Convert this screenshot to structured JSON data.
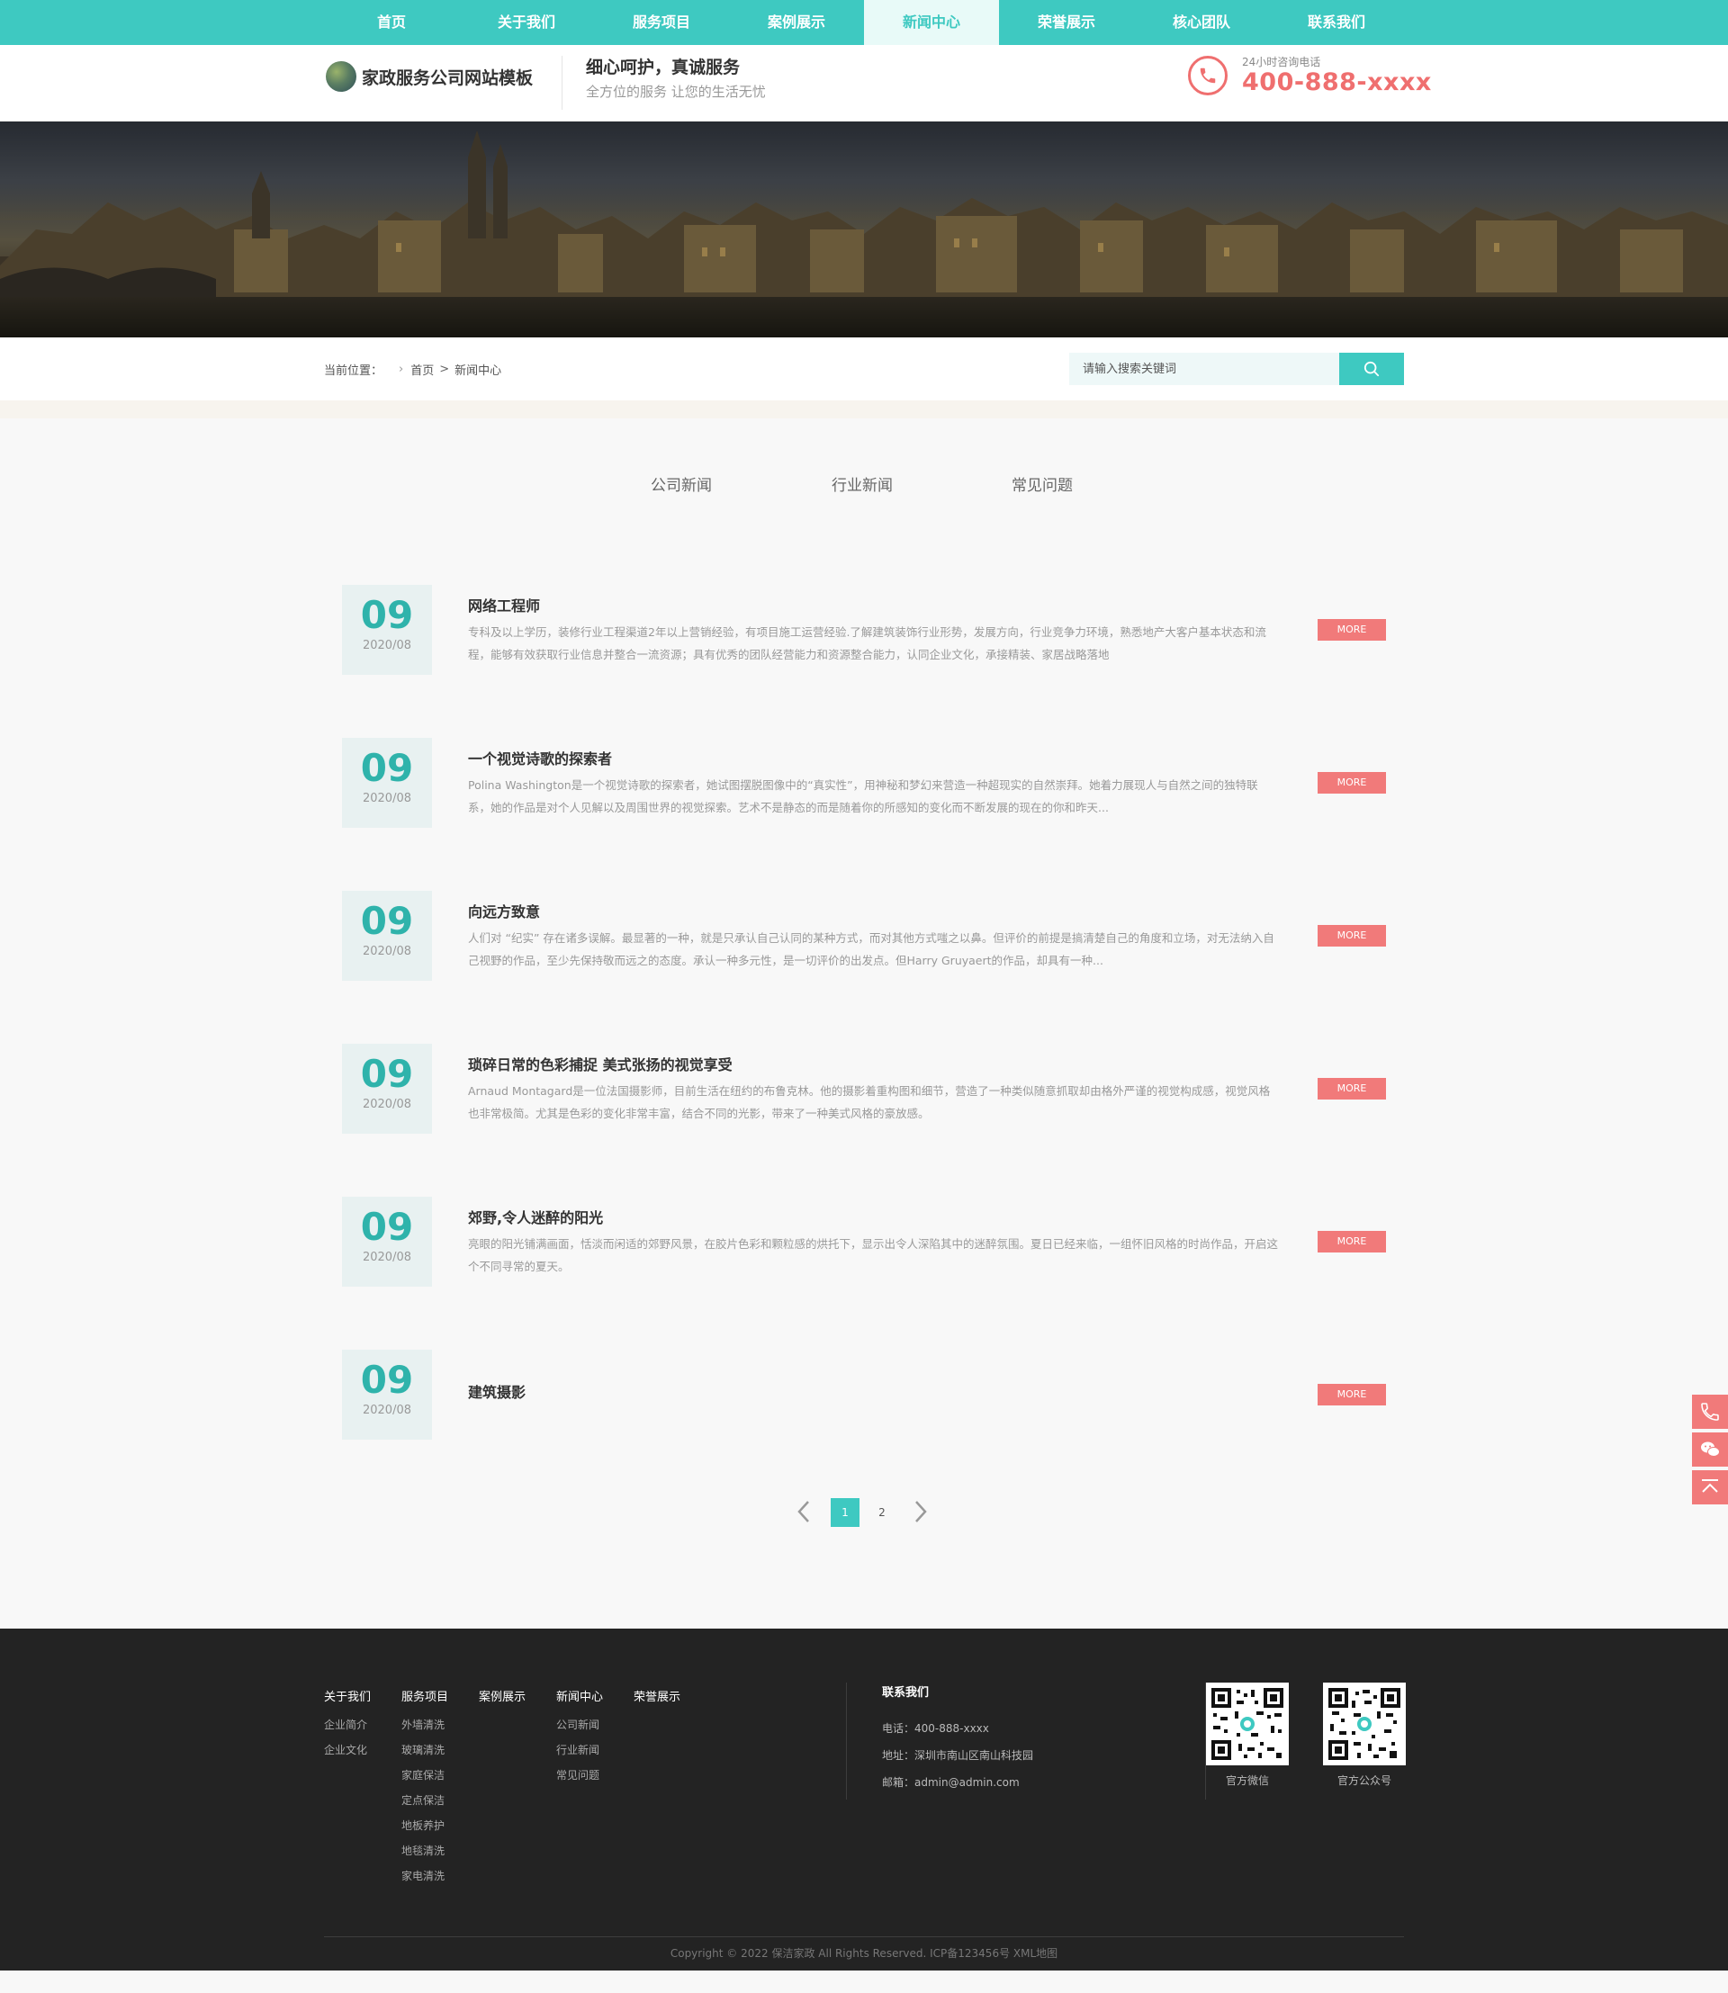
{
  "nav": [
    {
      "label": "首页"
    },
    {
      "label": "关于我们"
    },
    {
      "label": "服务项目"
    },
    {
      "label": "案例展示"
    },
    {
      "label": "新闻中心",
      "active": true
    },
    {
      "label": "荣誉展示"
    },
    {
      "label": "核心团队"
    },
    {
      "label": "联系我们"
    }
  ],
  "header": {
    "logo_text": "家政服务公司网站模板",
    "slogan_main": "细心呵护，真诚服务",
    "slogan_sub": "全方位的服务 让您的生活无忧",
    "phone_label": "24小时咨询电话",
    "phone_number": "400-888-xxxx"
  },
  "breadcrumb": {
    "label": "当前位置：",
    "home": "首页",
    "current": "新闻中心"
  },
  "search": {
    "placeholder": "请输入搜索关键词"
  },
  "tabs": [
    "公司新闻",
    "行业新闻",
    "常见问题"
  ],
  "news": [
    {
      "day": "09",
      "ym": "2020/08",
      "title": "网络工程师",
      "desc": "专科及以上学历，装修行业工程渠道2年以上营销经验，有项目施工运营经验.了解建筑装饰行业形势，发展方向，行业竞争力环境，熟悉地产大客户基本状态和流程，能够有效获取行业信息并整合一流资源；具有优秀的团队经营能力和资源整合能力，认同企业文化，承接精装、家居战略落地",
      "more": "MORE"
    },
    {
      "day": "09",
      "ym": "2020/08",
      "title": "一个视觉诗歌的探索者",
      "desc": "Polina Washington是一个视觉诗歌的探索者，她试图摆脱图像中的“真实性”，用神秘和梦幻来营造一种超现实的自然崇拜。她着力展现人与自然之间的独特联系，她的作品是对个人见解以及周围世界的视觉探索。艺术不是静态的而是随着你的所感知的变化而不断发展的现在的你和昨天...",
      "more": "MORE"
    },
    {
      "day": "09",
      "ym": "2020/08",
      "title": "向远方致意",
      "desc": "人们对 “纪实” 存在诸多误解。最显著的一种，就是只承认自己认同的某种方式，而对其他方式嗤之以鼻。但评价的前提是搞清楚自己的角度和立场，对无法纳入自己视野的作品，至少先保持敬而远之的态度。承认一种多元性，是一切评价的出发点。但Harry Gruyaert的作品，却具有一种...",
      "more": "MORE"
    },
    {
      "day": "09",
      "ym": "2020/08",
      "title": "琐碎日常的色彩捕捉 美式张扬的视觉享受",
      "desc": "Arnaud Montagard是一位法国摄影师，目前生活在纽约的布鲁克林。他的摄影着重构图和细节，营造了一种类似随意抓取却由格外严谨的视觉构成感，视觉风格也非常极简。尤其是色彩的变化非常丰富，结合不同的光影，带来了一种美式风格的豪放感。",
      "more": "MORE"
    },
    {
      "day": "09",
      "ym": "2020/08",
      "title": "郊野,令人迷醉的阳光",
      "desc": "亮眼的阳光铺满画面，恬淡而闲适的郊野风景，在胶片色彩和颗粒感的烘托下，显示出令人深陷其中的迷醉氛围。夏日已经来临，一组怀旧风格的时尚作品，开启这个不同寻常的夏天。",
      "more": "MORE"
    },
    {
      "day": "09",
      "ym": "2020/08",
      "title": "建筑摄影",
      "desc": "",
      "more": "MORE"
    }
  ],
  "pagination": {
    "pages": [
      "1",
      "2"
    ],
    "current": "1"
  },
  "footer": {
    "columns": [
      {
        "head": "关于我们",
        "links": [
          "企业简介",
          "企业文化"
        ]
      },
      {
        "head": "服务项目",
        "links": [
          "外墙清洗",
          "玻璃清洗",
          "家庭保洁",
          "定点保洁",
          "地板养护",
          "地毯清洗",
          "家电清洗"
        ]
      },
      {
        "head": "案例展示",
        "links": []
      },
      {
        "head": "新闻中心",
        "links": [
          "公司新闻",
          "行业新闻",
          "常见问题"
        ]
      },
      {
        "head": "荣誉展示",
        "links": []
      }
    ],
    "contact": {
      "head": "联系我们",
      "phone": "电话：400-888-xxxx",
      "address": "地址：深圳市南山区南山科技园",
      "email": "邮箱：admin@admin.com"
    },
    "qr": [
      {
        "caption": "官方微信"
      },
      {
        "caption": "官方公众号"
      }
    ],
    "copyright": "Copyright © 2022 保洁家政 All Rights Reserved. ICP备123456号 XML地图"
  },
  "colors": {
    "primary": "#3ec9c1",
    "accent": "#f17a7a",
    "footer_bg": "#232323"
  },
  "icons": {
    "phone": "phone-icon",
    "search": "search-icon",
    "side": [
      "phone-icon",
      "wechat-icon",
      "back-to-top-icon"
    ]
  }
}
